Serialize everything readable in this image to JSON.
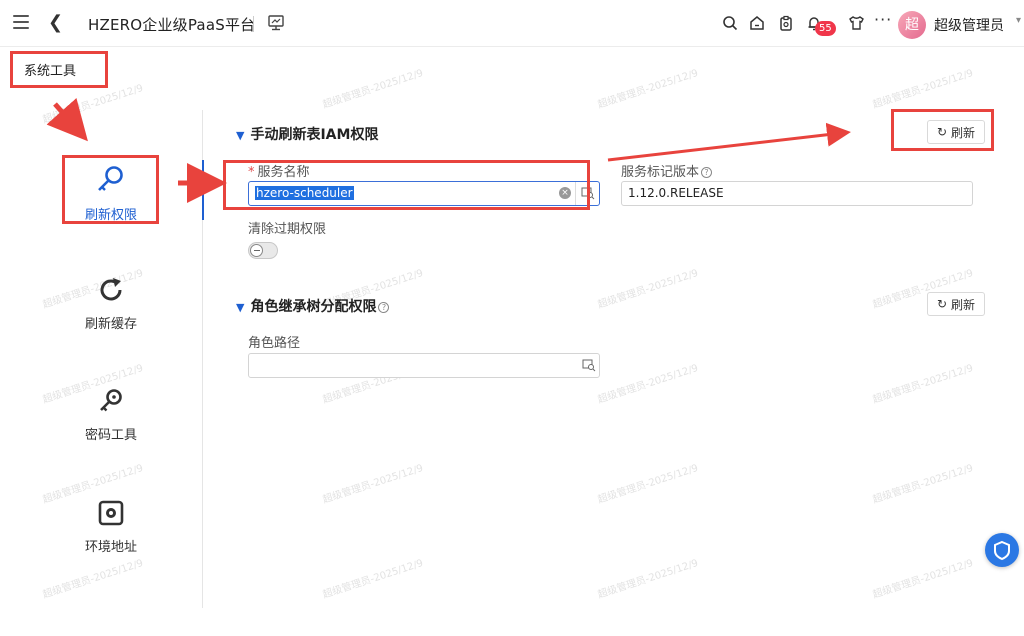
{
  "header": {
    "app_title": "HZERO企业级PaaS平台",
    "notification_count": "55",
    "avatar_text": "超",
    "user_name": "超级管理员",
    "more_label": "···"
  },
  "breadcrumb": "系统工具",
  "side_nav": [
    {
      "label": "刷新权限",
      "icon": "key-search-icon",
      "active": true
    },
    {
      "label": "刷新缓存",
      "icon": "refresh-icon",
      "active": false
    },
    {
      "label": "密码工具",
      "icon": "key-icon",
      "active": false
    },
    {
      "label": "环境地址",
      "icon": "environment-icon",
      "active": false
    }
  ],
  "section1": {
    "title": "手动刷新表IAM权限",
    "refresh_label": "刷新",
    "service_name_label": "服务名称",
    "service_name_value": "hzero-scheduler",
    "service_version_label": "服务标记版本",
    "service_version_value": "1.12.0.RELEASE",
    "clear_label": "清除过期权限"
  },
  "section2": {
    "title": "角色继承树分配权限",
    "refresh_label": "刷新",
    "role_path_label": "角色路径",
    "role_path_value": ""
  },
  "watermark_text": "超级管理员-2025/12/9",
  "colors": {
    "accent": "#1e5fd1",
    "annotation_red": "#e8433d",
    "badge": "#f0364a"
  }
}
